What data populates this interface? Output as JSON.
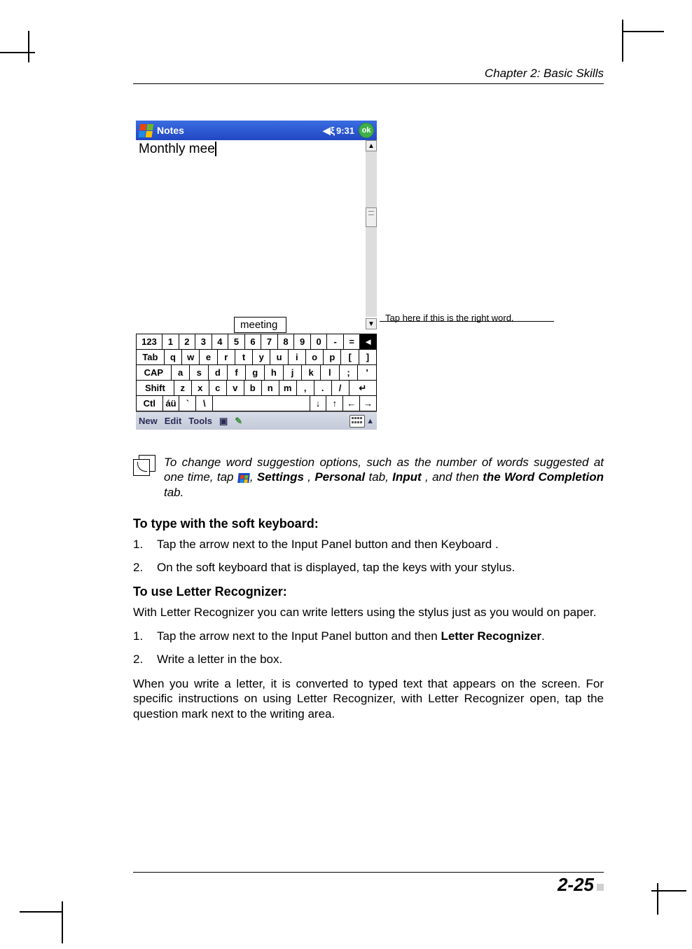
{
  "header": {
    "chapter": "Chapter 2: Basic Skills"
  },
  "screenshot": {
    "titlebar": {
      "app": "Notes",
      "time": "9:31",
      "ok": "ok"
    },
    "note_text": "Monthly mee",
    "suggestion": "meeting",
    "keyboard": {
      "row1": [
        "123",
        "1",
        "2",
        "3",
        "4",
        "5",
        "6",
        "7",
        "8",
        "9",
        "0",
        "-",
        "=",
        "◄"
      ],
      "row2": [
        "Tab",
        "q",
        "w",
        "e",
        "r",
        "t",
        "y",
        "u",
        "i",
        "o",
        "p",
        "[",
        "]"
      ],
      "row3": [
        "CAP",
        "a",
        "s",
        "d",
        "f",
        "g",
        "h",
        "j",
        "k",
        "l",
        ";",
        "'"
      ],
      "row4": [
        "Shift",
        "z",
        "x",
        "c",
        "v",
        "b",
        "n",
        "m",
        ",",
        ".",
        "/",
        "↵"
      ],
      "row5": [
        "Ctl",
        "áü",
        "`",
        "\\",
        " ",
        "↓",
        "↑",
        "←",
        "→"
      ]
    },
    "bottombar": {
      "items": [
        "New",
        "Edit",
        "Tools"
      ]
    }
  },
  "callout": "Tap here if this is the right word.",
  "note_tip": {
    "pre": "To change word suggestion options, such as the number of words suggested at one time, tap ",
    "mid1": ",  ",
    "settings": "Settings",
    "mid2": " ,  ",
    "personal": "Personal",
    "mid3": "  tab,  ",
    "input": "Input",
    "mid4": " , and then ",
    "the": "the",
    "wc": "  Word Completion",
    "end": "  tab."
  },
  "sectionA": {
    "title": "To type with the soft keyboard:",
    "steps": [
      "Tap the arrow next to the Input Panel button and then  Keyboard .",
      "On the soft keyboard that is displayed, tap the keys with your stylus."
    ]
  },
  "sectionB": {
    "title": "To use Letter Recognizer:",
    "intro": "With Letter Recognizer you can write letters using the stylus just as you would on paper.",
    "step1_pre": "Tap the arrow next to the Input Panel button and then  ",
    "step1_bold": "Letter Recognizer",
    "step1_post": ".",
    "step2": "Write a letter in the box.",
    "outro": "When you write a letter, it is converted to typed text that appears on the screen. For specific instructions on using Letter Recognizer, with Letter Recognizer open, tap the question mark next to the writing area."
  },
  "footer": {
    "page": "2-25"
  }
}
